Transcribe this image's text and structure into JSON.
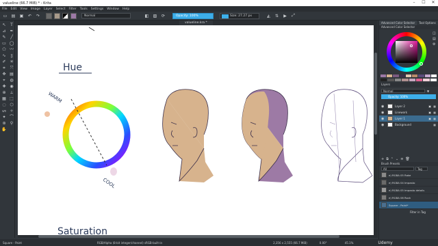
{
  "window": {
    "title": "valueline (66.7 MiB) * - Krita"
  },
  "menu": [
    "File",
    "Edit",
    "View",
    "Image",
    "Layer",
    "Select",
    "Filter",
    "Tools",
    "Settings",
    "Window",
    "Help"
  ],
  "toolbar": {
    "blend_mode": "Normal",
    "opacity_label": "Opacity: 100%",
    "size_label": "Size: 27.27 px"
  },
  "document_tab": "valueline.kra *",
  "canvas": {
    "hue_label": "Hue",
    "warm_label": "WARM",
    "cool_label": "COOL",
    "saturation_label": "Saturation"
  },
  "dockers": {
    "tabs": [
      "Advanced Color Selector",
      "Tool Options"
    ],
    "color_panel_title": "Advanced Color Selector",
    "layers_title": "Layers",
    "layers_blend": "Normal",
    "layers_opacity": "Opacity: 100%",
    "layers": [
      {
        "name": "Layer 2",
        "selected": false
      },
      {
        "name": "Linework",
        "selected": false
      },
      {
        "name": "Layer 1",
        "selected": true
      },
      {
        "name": "Background",
        "selected": false
      }
    ],
    "presets_title": "Brush Presets",
    "presets_filter": "All",
    "presets_tag": "Tag",
    "presets": [
      {
        "name": "e) RGBA 05 Rake",
        "selected": false
      },
      {
        "name": "e) RGBA 04 Impasto",
        "selected": false
      },
      {
        "name": "e) RGBA 05 Impasto details",
        "selected": false
      },
      {
        "name": "e) RGBA 06 Rock",
        "selected": false
      },
      {
        "name": "Square - Paint*",
        "selected": true
      }
    ],
    "filter_in_tag": "Filter in Tag"
  },
  "status": {
    "brush": "Square - Paint",
    "colorspace": "RGB/Alpha (8-bit integer/channel)  sRGB-built-in",
    "dimensions": "2,356 x 2,555 (66.7 MiB)",
    "zoom": "45.1%",
    "angle": "0.00°"
  },
  "watermark": "Udemy",
  "colors": {
    "accent": "#3daee9",
    "ui_bg": "#31363b",
    "skin": "#d6b48e",
    "shadow": "#9c79a6"
  }
}
